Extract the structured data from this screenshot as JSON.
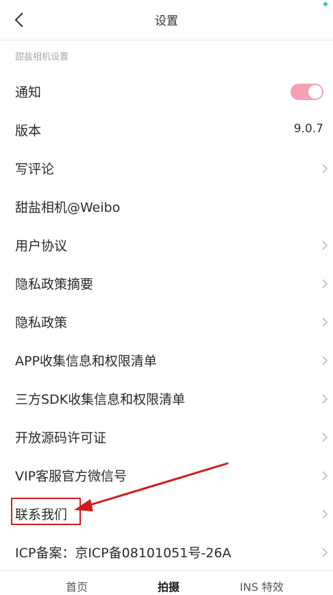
{
  "header": {
    "title": "设置",
    "status_dot_color": "#3dcc74"
  },
  "section": {
    "title": "甜盐相机设置"
  },
  "settings": {
    "notification": {
      "label": "通知",
      "toggle_on": true,
      "toggle_color": "#f6a0b4"
    },
    "version": {
      "label": "版本",
      "value": "9.0.7"
    },
    "review": {
      "label": "写评论"
    },
    "weibo": {
      "label": "甜盐相机@Weibo"
    },
    "agreement": {
      "label": "用户协议"
    },
    "privacy_summary": {
      "label": "隐私政策摘要"
    },
    "privacy": {
      "label": "隐私政策"
    },
    "app_info": {
      "label": "APP收集信息和权限清单"
    },
    "sdk_info": {
      "label": "三方SDK收集信息和权限清单"
    },
    "open_source": {
      "label": "开放源码许可证"
    },
    "vip_wechat": {
      "label": "VIP客服官方微信号"
    },
    "contact": {
      "label": "联系我们"
    },
    "icp": {
      "label": "ICP备案：京ICP备08101051号-26A"
    }
  },
  "tabs": [
    {
      "label": "首页",
      "active": false
    },
    {
      "label": "拍摄",
      "active": true
    },
    {
      "label": "INS 特效",
      "active": false
    }
  ],
  "annotation": {
    "color": "#d21a1a"
  }
}
